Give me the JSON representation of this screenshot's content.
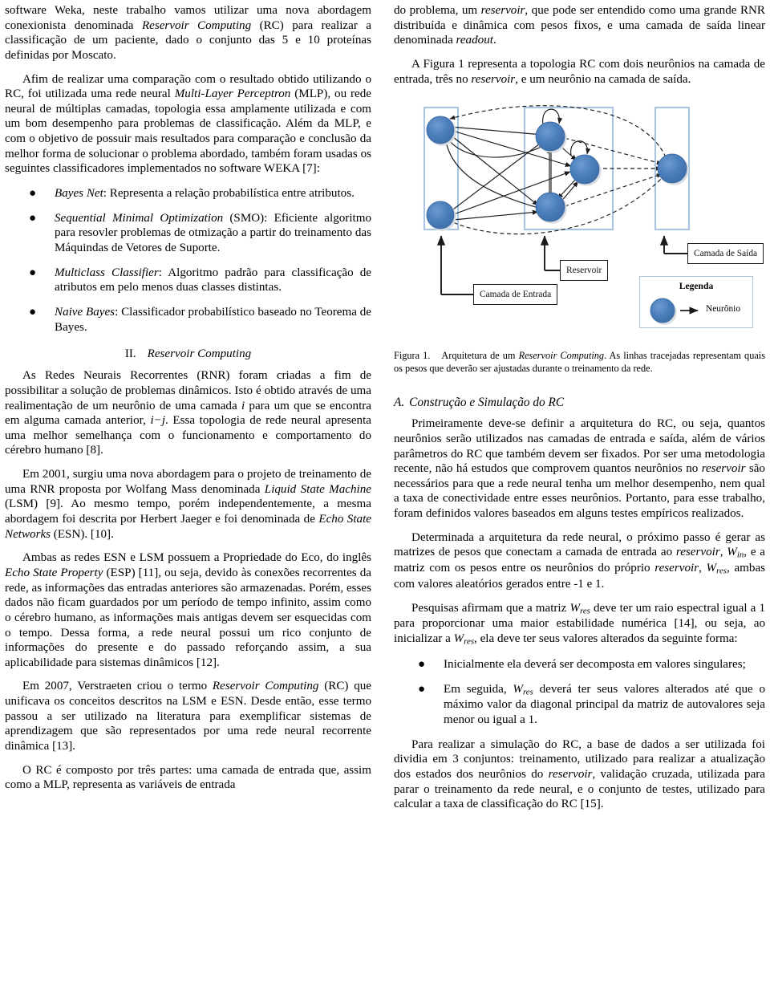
{
  "document": {
    "left_column": {
      "paragraphs": [
        "software Weka, neste trabalho vamos utilizar uma nova abordagem conexionista denominada |i|Reservoir Computing|/i| (RC) para realizar a classificação de um paciente, dado o conjunto das 5 e 10 proteínas definidas por Moscato.",
        "Afim de realizar uma comparação com o resultado obtido utilizando o RC, foi utilizada uma rede neural |i|Multi-Layer Perceptron|/i| (MLP), ou rede neural de múltiplas camadas, topologia essa amplamente utilizada e com um bom desempenho para problemas de classificação. Além da MLP, e com o objetivo de possuir mais resultados para comparação e conclusão da melhor forma de solucionar o problema abordado, também foram usadas os seguintes classificadores implementados no software WEKA [7]:"
      ],
      "classifier_list": [
        {
          "bullet": "●",
          "term": "Bayes Net",
          "text": ": Representa a relação probabilística entre atributos."
        },
        {
          "bullet": "●",
          "term": "Sequential Minimal Optimization",
          "text": " (SMO): Eficiente algoritmo para resovler problemas de otmização a partir do treinamento das Máquindas de Vetores de Suporte."
        },
        {
          "bullet": "●",
          "term": "Multiclass Classifier",
          "text": ": Algoritmo padrão para classificação de atributos em pelo menos duas classes distintas."
        },
        {
          "bullet": "●",
          "term": "Naive Bayes",
          "text": ": Classificador probabilístico baseado no Teorema de Bayes."
        }
      ],
      "section_heading": {
        "number": "II.",
        "title": "Reservoir Computing"
      },
      "section_paragraphs": [
        "As Redes Neurais Recorrentes (RNR) foram criadas a fim de possibilitar a solução de problemas dinâmicos. Isto é obtido através de uma realimentação de um neurônio de uma camada |m|i|/m| para um que se encontra em alguma camada anterior, |m|i−j|/m|. Essa topologia de rede neural apresenta uma melhor semelhança com o funcionamento e comportamento do cérebro humano [8].",
        "Em 2001, surgiu uma nova abordagem para o projeto de treinamento de uma RNR proposta por Wolfang Mass denominada |i|Liquid State Machine|/i| (LSM) [9]. Ao mesmo tempo, porém independentemente, a mesma abordagem foi descrita por Herbert Jaeger e foi denominada de |i|Echo State Networks|/i| (ESN). [10].",
        "Ambas as redes ESN e LSM possuem a Propriedade do Eco, do inglês |i|Echo State Property|/i| (ESP) [11], ou seja, devido às conexões recorrentes da rede, as informações das entradas anteriores são armazenadas. Porém, esses dados não ficam guardados por um período de tempo infinito, assim como o cérebro humano, as informações mais antigas devem ser esquecidas com o tempo. Dessa forma, a rede neural possui um rico conjunto de informações do presente e do passado reforçando assim, a sua aplicabilidade para sistemas dinâmicos [12].",
        "Em 2007, Verstraeten criou o termo |i|Reservoir Computing|/i| (RC) que unificava os conceitos descritos na LSM e ESN. Desde então, esse termo passou a ser utilizado na literatura para exemplificar sistemas de aprendizagem que são representados por uma rede neural recorrente dinâmica [13].",
        "O RC é composto por três partes: uma camada de entrada que, assim como a MLP, representa as variáveis de entrada"
      ]
    },
    "right_column": {
      "top_paragraphs": [
        "do problema, um |i|reservoir|/i|, que pode ser entendido como uma grande RNR distribuída e dinâmica com pesos fixos, e uma camada de saída linear denominada |i|readout|/i|.",
        "A Figura 1 representa a topologia RC com dois neurônios na camada de entrada, três no |i|reservoir|/i|, e um neurônio na camada de saída."
      ],
      "figure": {
        "labels": {
          "input_layer": "Camada de Entrada",
          "reservoir": "Reservoir",
          "output_layer": "Camada de Saída",
          "legend_title": "Legenda",
          "legend_item": "Neurônio"
        },
        "colors": {
          "node_fill": "#4a7ebb",
          "node_stroke": "#2f5f96",
          "layer_box_border": "#a8c4e0",
          "edge": "#1a1a1a",
          "label_box_border": "#1a1a1a"
        },
        "counts": {
          "input_neurons": 2,
          "reservoir_neurons": 3,
          "output_neurons": 1
        },
        "caption_label": "Figura 1.",
        "caption_text": "Arquitetura de um |i|Reservoir Computing|/i|. As linhas tracejadas representam quais os pesos que deverão ser ajustadas durante o treinamento da rede."
      },
      "subsection_heading": {
        "number": "A.",
        "title": "Construção e Simulação do RC"
      },
      "subsection_paragraphs": [
        "Primeiramente deve-se definir a arquitetura do RC, ou seja, quantos neurônios serão utilizados nas camadas de entrada e saída, além de vários parâmetros do RC que também devem ser fixados. Por ser uma metodologia recente, não há estudos que comprovem quantos neurônios no |i|reservoir|/i| são necessários para que a rede neural tenha um melhor desempenho, nem qual a taxa de conectividade entre esses neurônios. Portanto, para esse trabalho, foram definidos valores baseados em alguns testes empíricos realizados.",
        "Determinada a arquitetura da rede neural, o próximo passo é gerar as matrizes de pesos que conectam a camada de entrada ao |i|reservoir|/i|, |m|W_in|/m|, e a matriz com os pesos entre os neurônios do próprio |i|reservoir|/i|, |m|W_res|/m|, ambas com valores aleatórios gerados entre -1 e 1.",
        "Pesquisas afirmam que a matriz |m|W_res|/m| deve ter um raio espectral igual a 1 para proporcionar uma maior estabilidade numérica [14], ou seja, ao inicializar a |m|W_res|/m|, ela deve ter seus valores alterados da seguinte forma:"
      ],
      "matrix_list": [
        {
          "bullet": "●",
          "text": "Inicialmente ela deverá ser decomposta em valores singulares;"
        },
        {
          "bullet": "●",
          "text": "Em seguida, |m|W_res|/m| deverá ter seus valores alterados até que o máximo valor da diagonal principal da matriz de autovalores seja menor ou igual a 1."
        }
      ],
      "closing_paragraph": "Para realizar a simulação do RC, a base de dados a ser utilizada foi dividia em 3 conjuntos: treinamento, utilizado para realizar a atualização dos estados dos neurônios do |i|reservoir|/i|, validação cruzada, utilizada para parar o treinamento da rede neural, e o conjunto de testes, utilizado para calcular a taxa de classificação do RC [15]."
    }
  }
}
